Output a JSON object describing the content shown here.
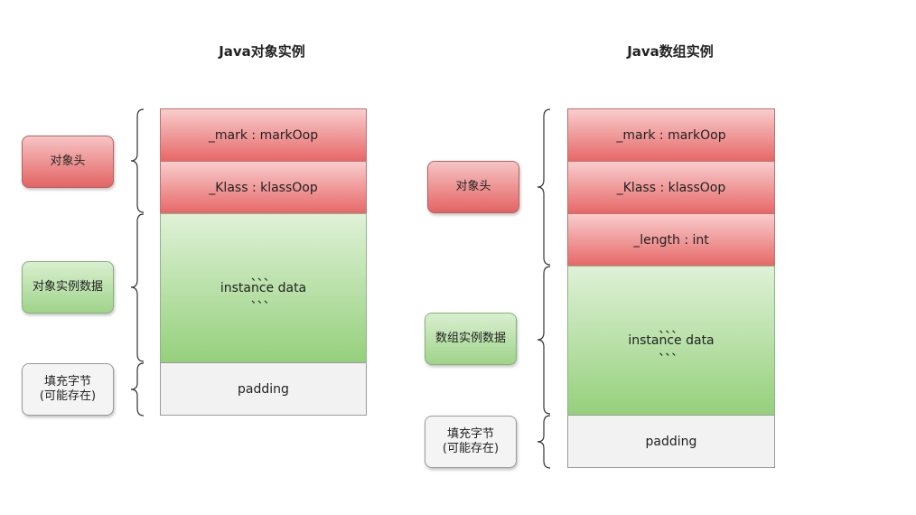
{
  "diagrams": [
    {
      "title": "Java对象实例",
      "labels": {
        "header": "对象头",
        "instance": "对象实例数据",
        "padding_line1": "填充字节",
        "padding_line2": "(可能存在)"
      },
      "cells": {
        "mark": "_mark : markOop",
        "klass": "_Klass : klassOop",
        "instance_ticks": "、、、",
        "instance_text": "instance data",
        "padding": "padding"
      }
    },
    {
      "title": "Java数组实例",
      "labels": {
        "header": "对象头",
        "instance": "数组实例数据",
        "padding_line1": "填充字节",
        "padding_line2": "(可能存在)"
      },
      "cells": {
        "mark": "_mark : markOop",
        "klass": "_Klass : klassOop",
        "length": "_length : int",
        "instance_ticks": "、、、",
        "instance_text": "instance data",
        "padding": "padding"
      }
    }
  ],
  "colors": {
    "header": "#e66868",
    "instance": "#95d07c",
    "padding": "#f2f2f2"
  }
}
